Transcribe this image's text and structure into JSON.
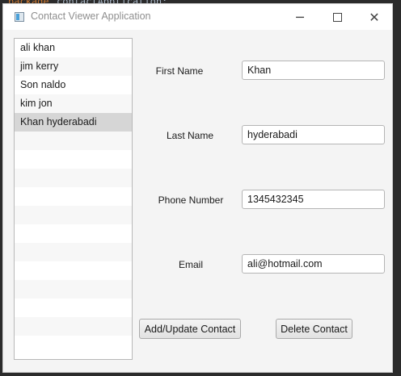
{
  "background_code": {
    "keyword": "package",
    "identifier": "contactApplication;"
  },
  "window": {
    "title": "Contact Viewer Application",
    "icon": "java-app-icon",
    "controls": {
      "minimize": "─",
      "close": "✕"
    }
  },
  "contacts": {
    "items": [
      "ali khan",
      "jim kerry",
      "Son naldo",
      "kim jon",
      "Khan hyderabadi"
    ],
    "selected_index": 4
  },
  "form": {
    "first_name": {
      "label": "First Name",
      "value": "Khan"
    },
    "last_name": {
      "label": "Last Name",
      "value": "hyderabadi"
    },
    "phone": {
      "label": "Phone Number",
      "value": "1345432345"
    },
    "email": {
      "label": "Email",
      "value": "ali@hotmail.com"
    }
  },
  "actions": {
    "add_update_label": "Add/Update Contact",
    "delete_label": "Delete Contact"
  }
}
